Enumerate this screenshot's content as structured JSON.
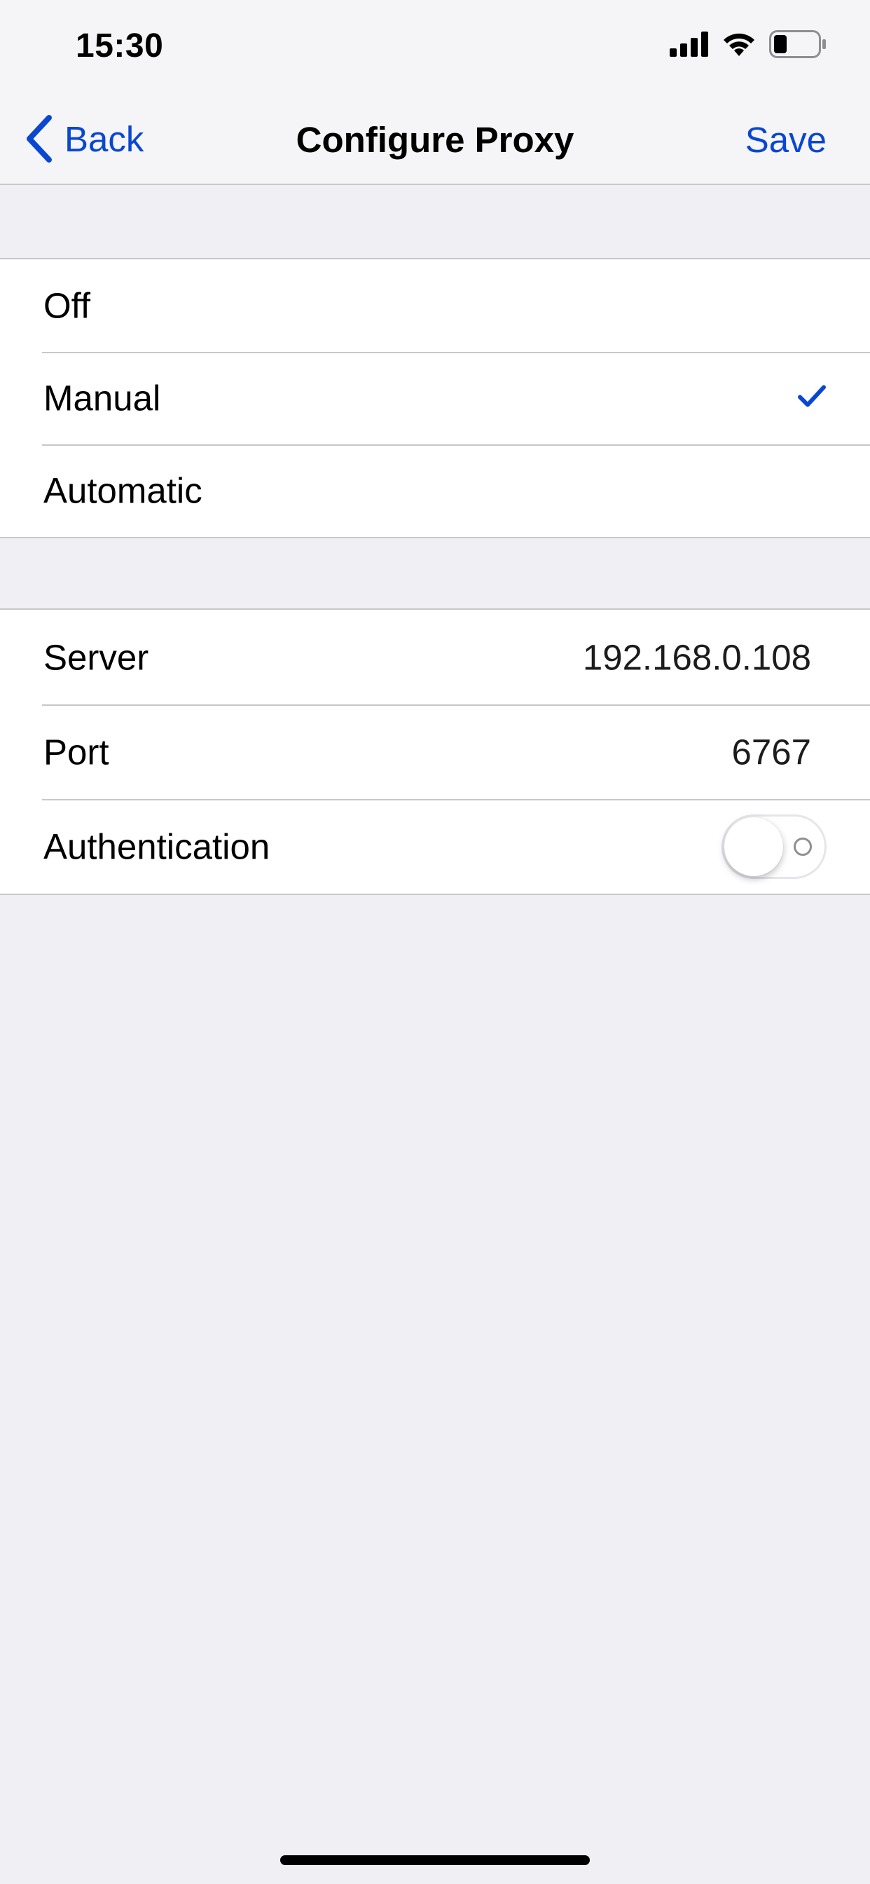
{
  "status_bar": {
    "time": "15:30"
  },
  "nav": {
    "back_label": "Back",
    "title": "Configure Proxy",
    "save_label": "Save"
  },
  "proxy_modes": {
    "options": [
      {
        "label": "Off",
        "selected": false
      },
      {
        "label": "Manual",
        "selected": true
      },
      {
        "label": "Automatic",
        "selected": false
      }
    ]
  },
  "proxy_settings": {
    "server": {
      "label": "Server",
      "value": "192.168.0.108"
    },
    "port": {
      "label": "Port",
      "value": "6767"
    },
    "authentication": {
      "label": "Authentication",
      "enabled": false
    }
  },
  "colors": {
    "accent": "#0a47d1",
    "background": "#efeff4",
    "separator": "#c7c7cc"
  },
  "icons": [
    "signal-icon",
    "wifi-icon",
    "battery-icon",
    "chevron-left-icon",
    "checkmark-icon"
  ]
}
